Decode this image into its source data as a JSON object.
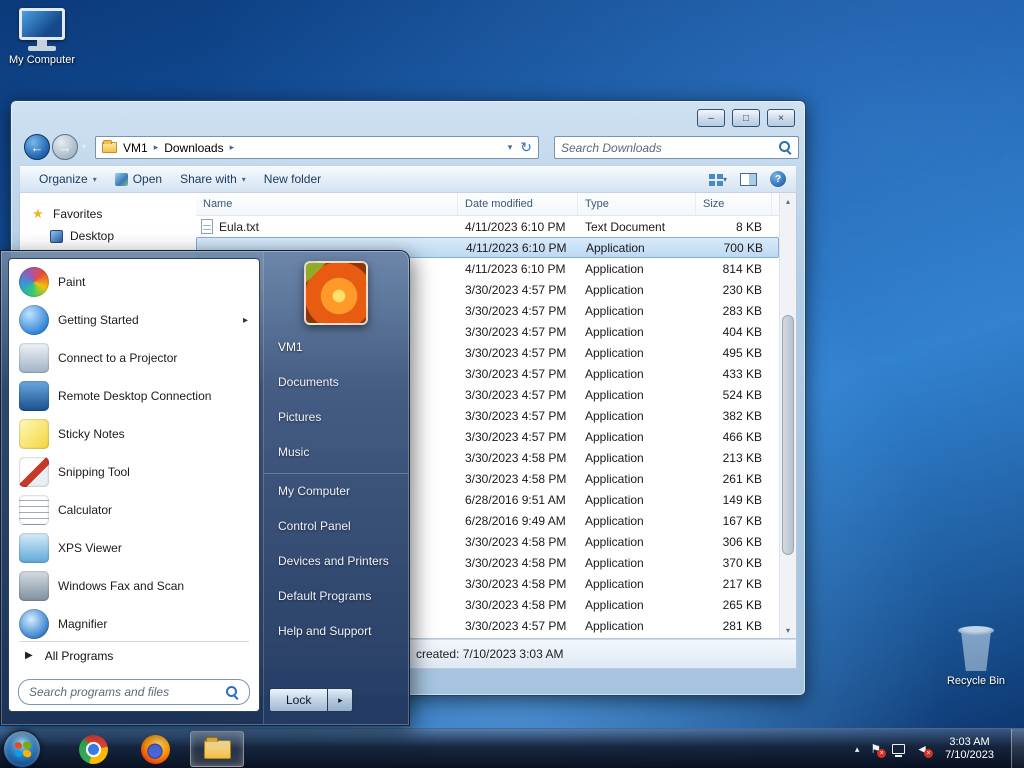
{
  "icons": {
    "back": "←",
    "forward": "→",
    "dropdown": "▾",
    "crumb_sep": "▸",
    "refresh": "↻",
    "submenu_arrow": "▸",
    "all_programs_arrow": "▶",
    "scroll_up": "▴",
    "scroll_down": "▾",
    "help_glyph": "?",
    "flag": "⚑",
    "chevron_up": "▴",
    "speaker": "◄",
    "badge_x": "×"
  },
  "desktop": {
    "my_computer_label": "My Computer",
    "recycle_bin_label": "Recycle Bin"
  },
  "explorer": {
    "caption_buttons": {
      "minimize": "–",
      "maximize": "□",
      "close": "×"
    },
    "address": {
      "crumbs": [
        {
          "label": "VM1"
        },
        {
          "label": "Downloads"
        }
      ],
      "search_placeholder": "Search Downloads"
    },
    "toolbar": {
      "organize": "Organize",
      "open": "Open",
      "share": "Share with",
      "new_folder": "New folder"
    },
    "sidebar": {
      "items": [
        {
          "label": "Favorites",
          "icon": "favorites-star-icon"
        },
        {
          "label": "Desktop",
          "icon": "desktop-small-icon"
        }
      ]
    },
    "columns": [
      {
        "label": "Name"
      },
      {
        "label": "Date modified"
      },
      {
        "label": "Type"
      },
      {
        "label": "Size"
      }
    ],
    "rows": [
      {
        "name": "Eula.txt",
        "date": "4/11/2023 6:10 PM",
        "type": "Text Document",
        "size": "8 KB",
        "icon": "text-document-icon"
      },
      {
        "name": "",
        "date": "4/11/2023 6:10 PM",
        "type": "Application",
        "size": "700 KB",
        "selected": true
      },
      {
        "name": "",
        "date": "4/11/2023 6:10 PM",
        "type": "Application",
        "size": "814 KB"
      },
      {
        "name": "",
        "date": "3/30/2023 4:57 PM",
        "type": "Application",
        "size": "230 KB"
      },
      {
        "name": "",
        "date": "3/30/2023 4:57 PM",
        "type": "Application",
        "size": "283 KB"
      },
      {
        "name": "",
        "date": "3/30/2023 4:57 PM",
        "type": "Application",
        "size": "404 KB"
      },
      {
        "name": "",
        "date": "3/30/2023 4:57 PM",
        "type": "Application",
        "size": "495 KB"
      },
      {
        "name": "",
        "date": "3/30/2023 4:57 PM",
        "type": "Application",
        "size": "433 KB"
      },
      {
        "name": "",
        "date": "3/30/2023 4:57 PM",
        "type": "Application",
        "size": "524 KB"
      },
      {
        "name": "",
        "date": "3/30/2023 4:57 PM",
        "type": "Application",
        "size": "382 KB"
      },
      {
        "name": "",
        "date": "3/30/2023 4:57 PM",
        "type": "Application",
        "size": "466 KB"
      },
      {
        "name": "",
        "date": "3/30/2023 4:58 PM",
        "type": "Application",
        "size": "213 KB"
      },
      {
        "name": "",
        "date": "3/30/2023 4:58 PM",
        "type": "Application",
        "size": "261 KB"
      },
      {
        "name": "",
        "date": "6/28/2016 9:51 AM",
        "type": "Application",
        "size": "149 KB"
      },
      {
        "name": "",
        "date": "6/28/2016 9:49 AM",
        "type": "Application",
        "size": "167 KB"
      },
      {
        "name": "",
        "date": "3/30/2023 4:58 PM",
        "type": "Application",
        "size": "306 KB"
      },
      {
        "name": "",
        "date": "3/30/2023 4:58 PM",
        "type": "Application",
        "size": "370 KB"
      },
      {
        "name": "",
        "date": "3/30/2023 4:58 PM",
        "type": "Application",
        "size": "217 KB"
      },
      {
        "name": "",
        "date": "3/30/2023 4:58 PM",
        "type": "Application",
        "size": "265 KB"
      },
      {
        "name": "",
        "date": "3/30/2023 4:57 PM",
        "type": "Application",
        "size": "281 KB"
      }
    ],
    "details_pane": {
      "text": "created: 7/10/2023 3:03 AM"
    }
  },
  "start_menu": {
    "left_items": [
      {
        "label": "Paint",
        "icon": "paint-icon"
      },
      {
        "label": "Getting Started",
        "icon": "getting-started-icon",
        "submenu": true
      },
      {
        "label": "Connect to a Projector",
        "icon": "projector-icon"
      },
      {
        "label": "Remote Desktop Connection",
        "icon": "remote-desktop-icon"
      },
      {
        "label": "Sticky Notes",
        "icon": "sticky-notes-icon"
      },
      {
        "label": "Snipping Tool",
        "icon": "snipping-tool-icon"
      },
      {
        "label": "Calculator",
        "icon": "calculator-icon"
      },
      {
        "label": "XPS Viewer",
        "icon": "xps-viewer-icon"
      },
      {
        "label": "Windows Fax and Scan",
        "icon": "fax-scan-icon"
      },
      {
        "label": "Magnifier",
        "icon": "magnifier-icon"
      }
    ],
    "all_programs": "All Programs",
    "search_placeholder": "Search programs and files",
    "user_name": "VM1",
    "right_items": [
      {
        "label": "Documents"
      },
      {
        "label": "Pictures"
      },
      {
        "label": "Music"
      },
      {
        "label": "My Computer",
        "sep": true
      },
      {
        "label": "Control Panel"
      },
      {
        "label": "Devices and Printers"
      },
      {
        "label": "Default Programs"
      },
      {
        "label": "Help and Support"
      }
    ],
    "lock_label": "Lock"
  },
  "taskbar": {
    "clock_time": "3:03 AM",
    "clock_date": "7/10/2023"
  }
}
